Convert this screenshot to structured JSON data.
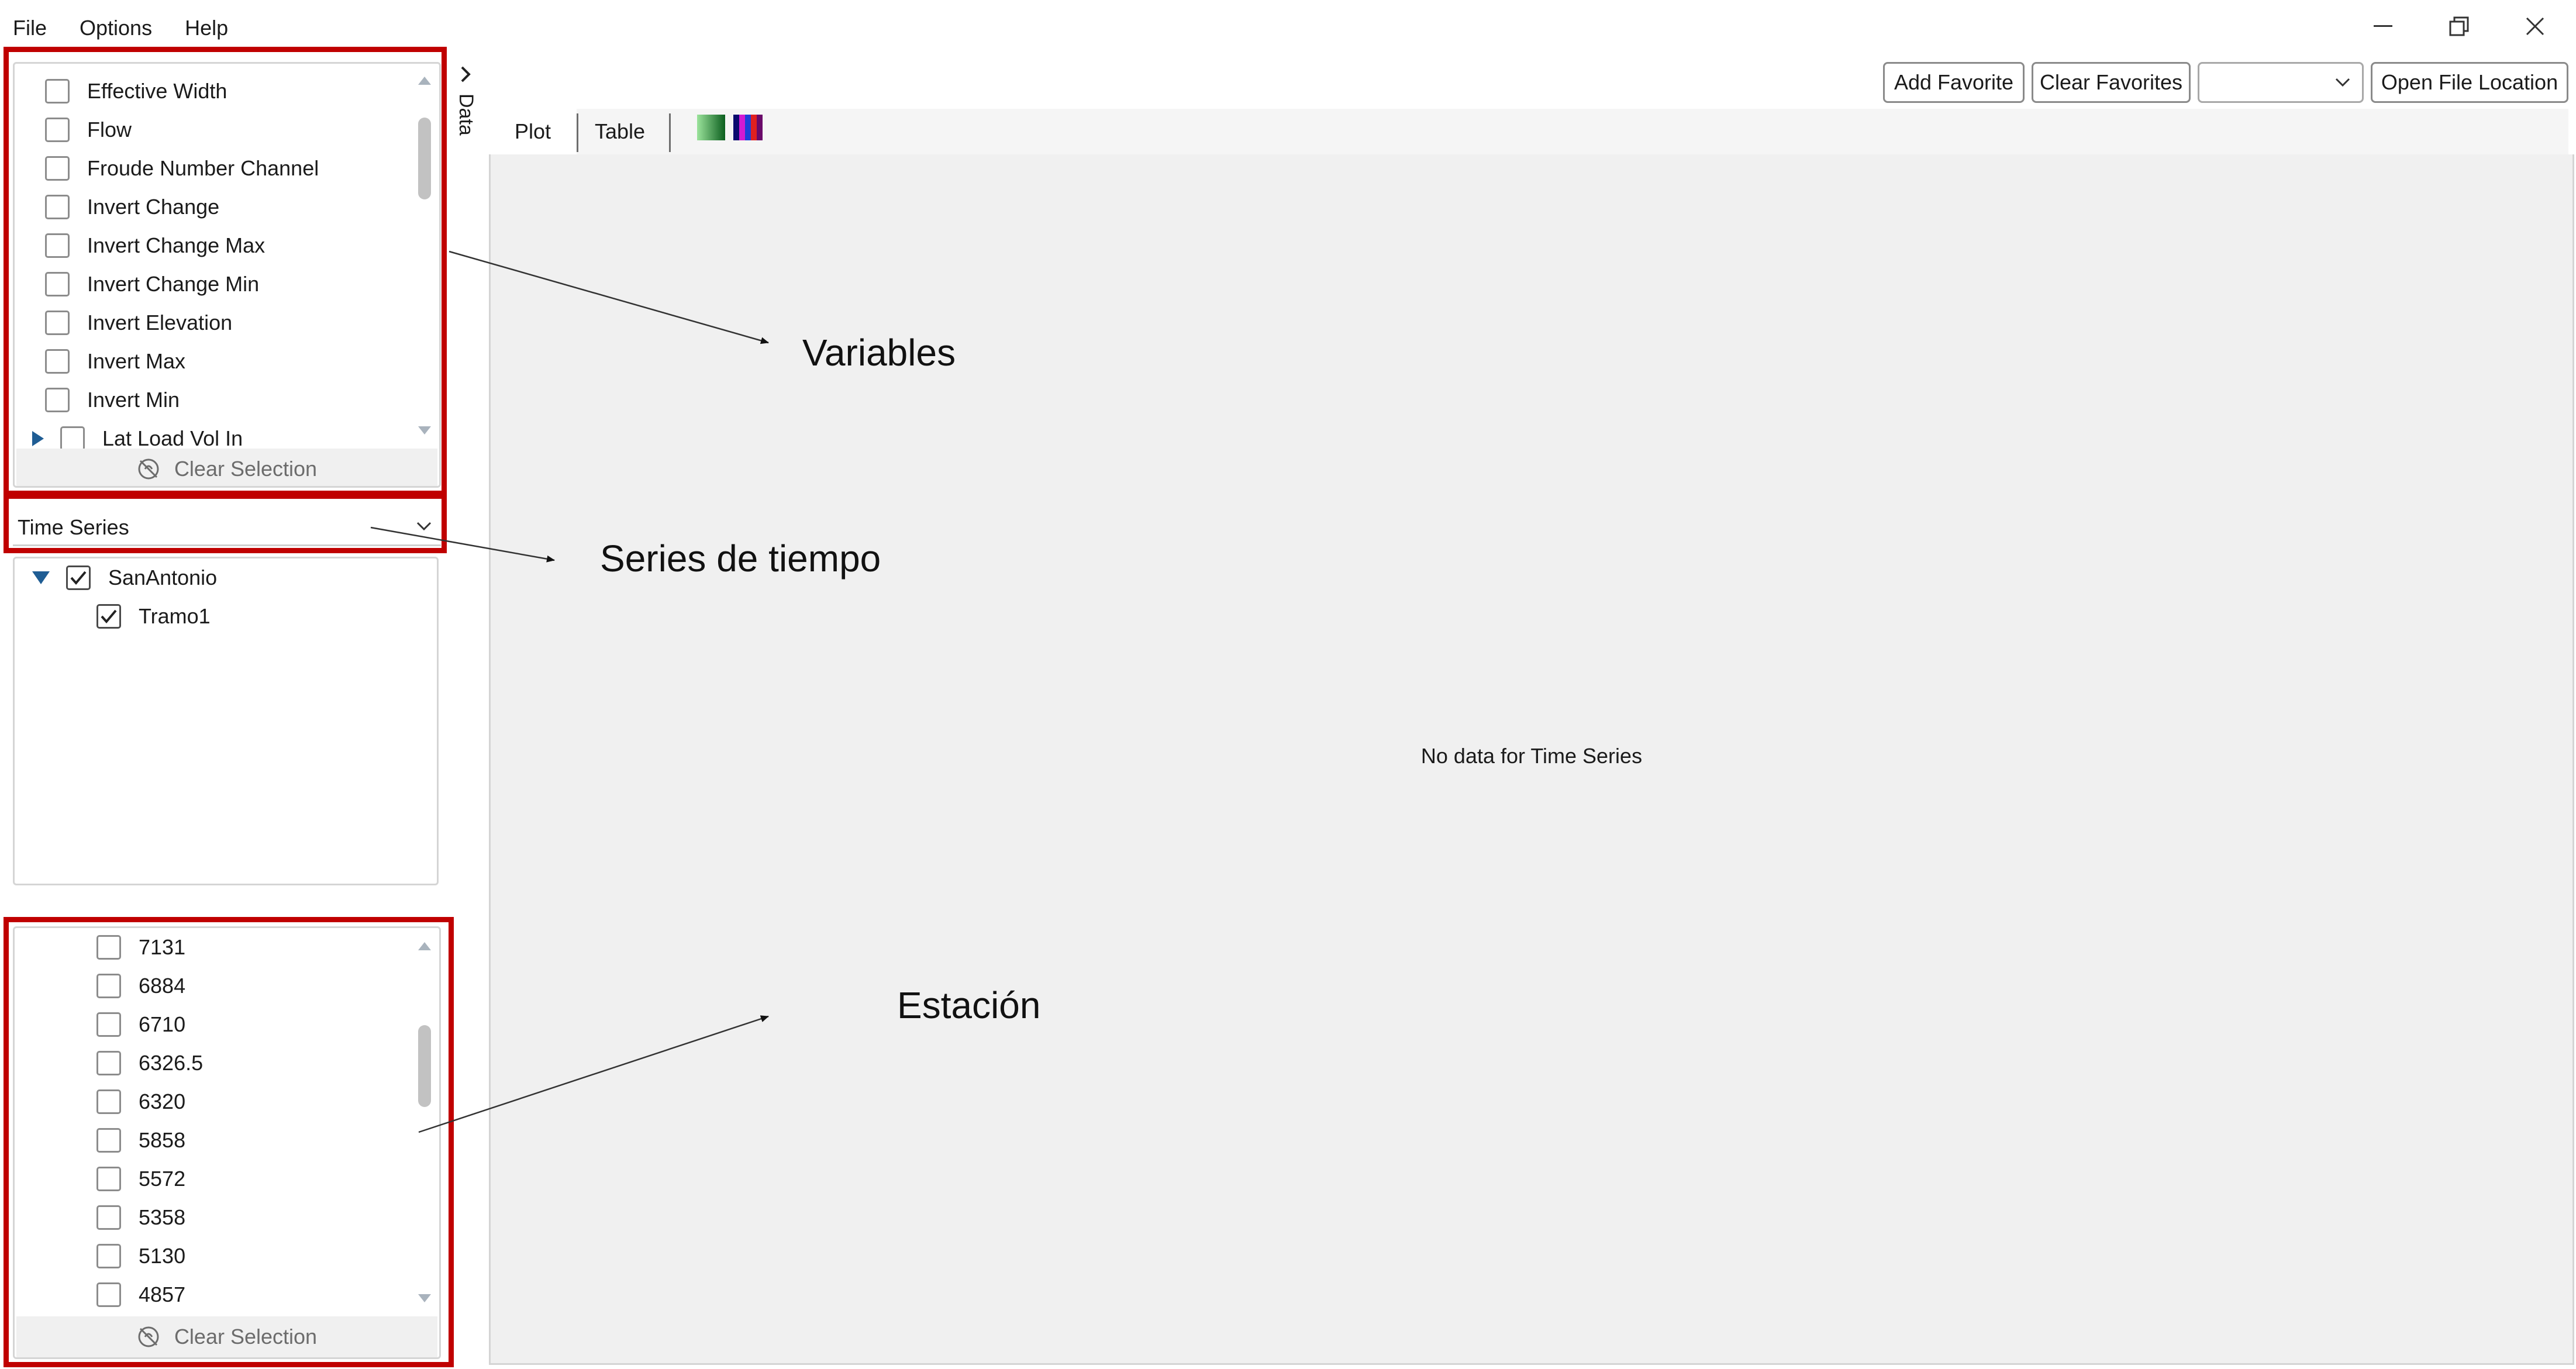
{
  "menu": [
    "File",
    "Options",
    "Help"
  ],
  "window_controls": {
    "minimize": "minimize-icon",
    "restore": "restore-icon",
    "close": "close-icon"
  },
  "panel_toggle": {
    "label": "Data",
    "icon": "chevron-right-icon"
  },
  "variables": {
    "items": [
      {
        "label": "Effective Width",
        "checked": false
      },
      {
        "label": "Flow",
        "checked": false
      },
      {
        "label": "Froude Number Channel",
        "checked": false
      },
      {
        "label": "Invert Change",
        "checked": false
      },
      {
        "label": "Invert Change Max",
        "checked": false
      },
      {
        "label": "Invert Change Min",
        "checked": false
      },
      {
        "label": "Invert Elevation",
        "checked": false
      },
      {
        "label": "Invert Max",
        "checked": false
      },
      {
        "label": "Invert Min",
        "checked": false
      },
      {
        "label": "Lat Load Vol In",
        "checked": false,
        "expandable": true
      }
    ],
    "clear_label": "Clear Selection"
  },
  "series_type": {
    "selected": "Time Series"
  },
  "tree": {
    "root": {
      "label": "SanAntonio",
      "checked": true
    },
    "child": {
      "label": "Tramo1",
      "checked": true
    }
  },
  "stations": {
    "items": [
      {
        "label": "7131",
        "checked": false
      },
      {
        "label": "6884",
        "checked": false
      },
      {
        "label": "6710",
        "checked": false
      },
      {
        "label": "6326.5",
        "checked": false
      },
      {
        "label": "6320",
        "checked": false
      },
      {
        "label": "5858",
        "checked": false
      },
      {
        "label": "5572",
        "checked": false
      },
      {
        "label": "5358",
        "checked": false
      },
      {
        "label": "5130",
        "checked": false
      },
      {
        "label": "4857",
        "checked": false
      }
    ],
    "clear_label": "Clear Selection"
  },
  "toolbar": {
    "add_favorite": "Add Favorite",
    "clear_favorites": "Clear Favorites",
    "favorites_selected": "",
    "open_file_location": "Open File Location"
  },
  "tabs": {
    "plot": "Plot",
    "table": "Table",
    "active": "Plot"
  },
  "plot": {
    "message": "No data for Time Series"
  },
  "annotations": {
    "variables": "Variables",
    "series": "Series de tiempo",
    "station": "Estación"
  },
  "colors": {
    "annotation_box": "#c00000",
    "expander": "#1f5d94",
    "plot_background": "#f0f0f0"
  }
}
